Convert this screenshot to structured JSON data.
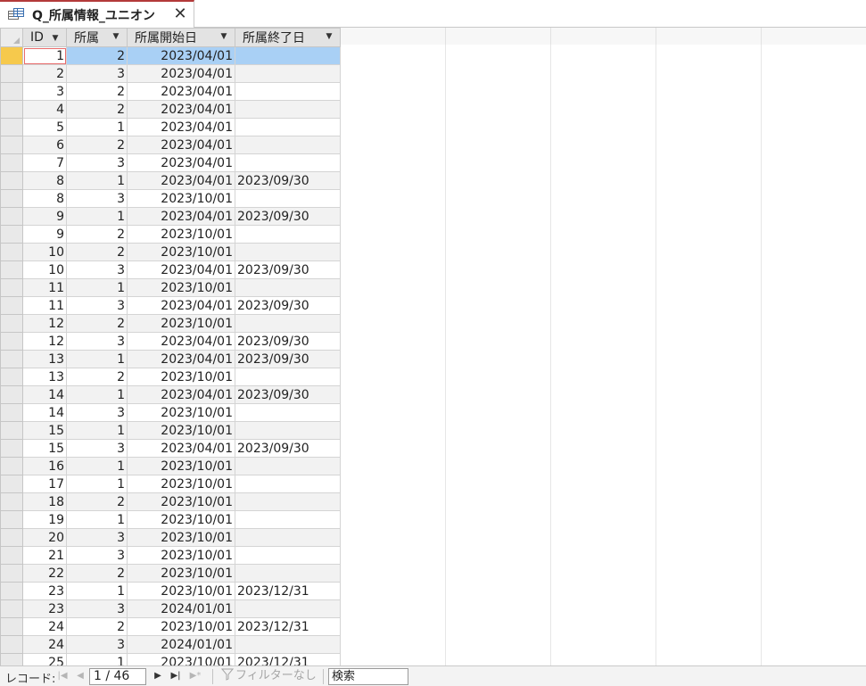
{
  "tab": {
    "title": "Q_所属情報_ユニオン",
    "close_glyph": "✕"
  },
  "columns": [
    {
      "key": "id",
      "label": "ID"
    },
    {
      "key": "shozoku",
      "label": "所属"
    },
    {
      "key": "start",
      "label": "所属開始日"
    },
    {
      "key": "end",
      "label": "所属終了日"
    }
  ],
  "rows": [
    {
      "id": "1",
      "shozoku": "2",
      "start": "2023/04/01",
      "end": ""
    },
    {
      "id": "2",
      "shozoku": "3",
      "start": "2023/04/01",
      "end": ""
    },
    {
      "id": "3",
      "shozoku": "2",
      "start": "2023/04/01",
      "end": ""
    },
    {
      "id": "4",
      "shozoku": "2",
      "start": "2023/04/01",
      "end": ""
    },
    {
      "id": "5",
      "shozoku": "1",
      "start": "2023/04/01",
      "end": ""
    },
    {
      "id": "6",
      "shozoku": "2",
      "start": "2023/04/01",
      "end": ""
    },
    {
      "id": "7",
      "shozoku": "3",
      "start": "2023/04/01",
      "end": ""
    },
    {
      "id": "8",
      "shozoku": "1",
      "start": "2023/04/01",
      "end": "2023/09/30"
    },
    {
      "id": "8",
      "shozoku": "3",
      "start": "2023/10/01",
      "end": ""
    },
    {
      "id": "9",
      "shozoku": "1",
      "start": "2023/04/01",
      "end": "2023/09/30"
    },
    {
      "id": "9",
      "shozoku": "2",
      "start": "2023/10/01",
      "end": ""
    },
    {
      "id": "10",
      "shozoku": "2",
      "start": "2023/10/01",
      "end": ""
    },
    {
      "id": "10",
      "shozoku": "3",
      "start": "2023/04/01",
      "end": "2023/09/30"
    },
    {
      "id": "11",
      "shozoku": "1",
      "start": "2023/10/01",
      "end": ""
    },
    {
      "id": "11",
      "shozoku": "3",
      "start": "2023/04/01",
      "end": "2023/09/30"
    },
    {
      "id": "12",
      "shozoku": "2",
      "start": "2023/10/01",
      "end": ""
    },
    {
      "id": "12",
      "shozoku": "3",
      "start": "2023/04/01",
      "end": "2023/09/30"
    },
    {
      "id": "13",
      "shozoku": "1",
      "start": "2023/04/01",
      "end": "2023/09/30"
    },
    {
      "id": "13",
      "shozoku": "2",
      "start": "2023/10/01",
      "end": ""
    },
    {
      "id": "14",
      "shozoku": "1",
      "start": "2023/04/01",
      "end": "2023/09/30"
    },
    {
      "id": "14",
      "shozoku": "3",
      "start": "2023/10/01",
      "end": ""
    },
    {
      "id": "15",
      "shozoku": "1",
      "start": "2023/10/01",
      "end": ""
    },
    {
      "id": "15",
      "shozoku": "3",
      "start": "2023/04/01",
      "end": "2023/09/30"
    },
    {
      "id": "16",
      "shozoku": "1",
      "start": "2023/10/01",
      "end": ""
    },
    {
      "id": "17",
      "shozoku": "1",
      "start": "2023/10/01",
      "end": ""
    },
    {
      "id": "18",
      "shozoku": "2",
      "start": "2023/10/01",
      "end": ""
    },
    {
      "id": "19",
      "shozoku": "1",
      "start": "2023/10/01",
      "end": ""
    },
    {
      "id": "20",
      "shozoku": "3",
      "start": "2023/10/01",
      "end": ""
    },
    {
      "id": "21",
      "shozoku": "3",
      "start": "2023/10/01",
      "end": ""
    },
    {
      "id": "22",
      "shozoku": "2",
      "start": "2023/10/01",
      "end": ""
    },
    {
      "id": "23",
      "shozoku": "1",
      "start": "2023/10/01",
      "end": "2023/12/31"
    },
    {
      "id": "23",
      "shozoku": "3",
      "start": "2024/01/01",
      "end": ""
    },
    {
      "id": "24",
      "shozoku": "2",
      "start": "2023/10/01",
      "end": "2023/12/31"
    },
    {
      "id": "24",
      "shozoku": "3",
      "start": "2024/01/01",
      "end": ""
    },
    {
      "id": "25",
      "shozoku": "1",
      "start": "2023/10/01",
      "end": "2023/12/31"
    }
  ],
  "navbar": {
    "record_label": "レコード:",
    "record_position": "1 / 46",
    "filter_label": "フィルターなし",
    "search_label": "検索"
  },
  "colors": {
    "tab_accent": "#b33a3a",
    "selected_row": "#a9d0f5",
    "selected_selector": "#f6c94c"
  }
}
